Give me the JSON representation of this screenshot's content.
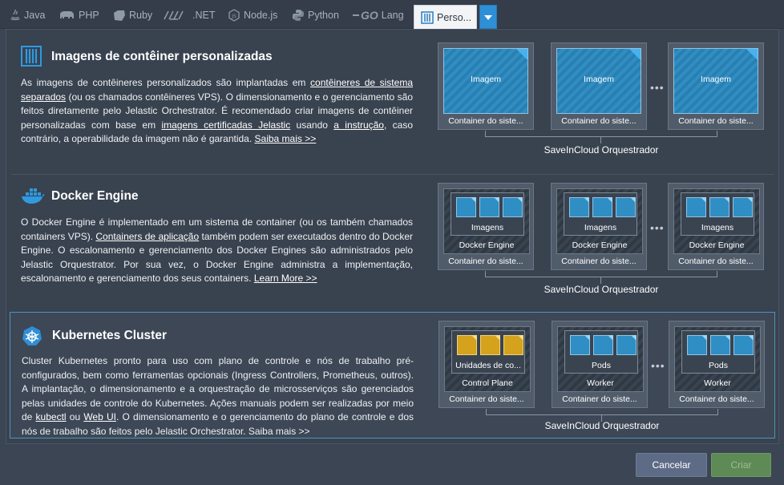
{
  "tabs": [
    {
      "label": "Java",
      "icon": "java-icon"
    },
    {
      "label": "PHP",
      "icon": "php-icon"
    },
    {
      "label": "Ruby",
      "icon": "ruby-icon"
    },
    {
      "label": ".NET",
      "icon": "dotnet-icon"
    },
    {
      "label": "Node.js",
      "icon": "nodejs-icon"
    },
    {
      "label": "Python",
      "icon": "python-icon"
    },
    {
      "label": "Lang",
      "icon": "go-icon",
      "icon_text": "GO"
    },
    {
      "label": "Perso...",
      "icon": "custom-containers-icon",
      "active": true
    }
  ],
  "sections": {
    "custom": {
      "title": "Imagens de contêiner personalizadas",
      "d1": "As imagens de contêineres personalizados são implantadas em ",
      "l1": "contêineres de sistema separados",
      "d2": " (ou os chamados contêineres VPS). O dimensionamento e o gerenciamento são feitos diretamente pelo Jelastic Orchestrator. É recomendado criar imagens de contêiner personalizadas com base em ",
      "l2": "imagens certificadas Jelastic",
      "d3": " usando ",
      "l3": "a instrução",
      "d4": ", caso contrário, a operabilidade da imagem não é garantida. ",
      "l4": "Saiba mais >>",
      "image_label": "Imagem",
      "node_caption": "Container do siste...",
      "orchestrator": "SaveInCloud Orquestrador",
      "dots": "•••"
    },
    "docker": {
      "title": "Docker Engine",
      "d1": "O Docker Engine é implementado em um sistema de container (ou os também chamados containers VPS). ",
      "l1": "Containers de aplicação",
      "d2": " também podem ser executados dentro do Docker Engine. O escalonamento e gerenciamento dos Docker Engines são administrados pelo Jelastic Orquestrator. Por sua vez, o Docker Engine administra a implementação, escalonamento e gerenciamento dos seus containers. ",
      "l2": "Learn More >>",
      "inner_label": "Imagens",
      "engine_label": "Docker Engine",
      "node_caption": "Container do siste...",
      "orchestrator": "SaveInCloud Orquestrador",
      "dots": "•••"
    },
    "k8s": {
      "title": "Kubernetes Cluster",
      "d1": "Cluster Kubernetes pronto para uso com plano de controle e nós de trabalho pré-configurados, bem como ferramentas opcionais (Ingress Controllers, Prometheus, outros). A implantação, o dimensionamento e a orquestração de microsserviços são gerenciados pelas unidades de controle do Kubernetes. Ações manuais podem ser realizadas por meio de ",
      "l1": "kubectl",
      "d2": " ou ",
      "l2": "Web UI",
      "d3": ". O dimensionamento e o gerenciamento do plano de controle e dos nós de trabalho são feitos pelo Jelastic Orchestrator. ",
      "l3": "Saiba mais >>",
      "cp_inner": "Unidades de co...",
      "cp_label": "Control Plane",
      "pods_label": "Pods",
      "worker_label": "Worker",
      "node_caption": "Container do siste...",
      "orchestrator": "SaveInCloud Orquestrador",
      "dots": "•••"
    }
  },
  "footer": {
    "cancel": "Cancelar",
    "create": "Criar"
  },
  "colors": {
    "accent": "#2d8fd6",
    "image_blue": "#2f8ec4",
    "control_plane_yellow": "#d4a21c",
    "create_green": "#5e8a55",
    "cancel_slate": "#5e6b86"
  }
}
